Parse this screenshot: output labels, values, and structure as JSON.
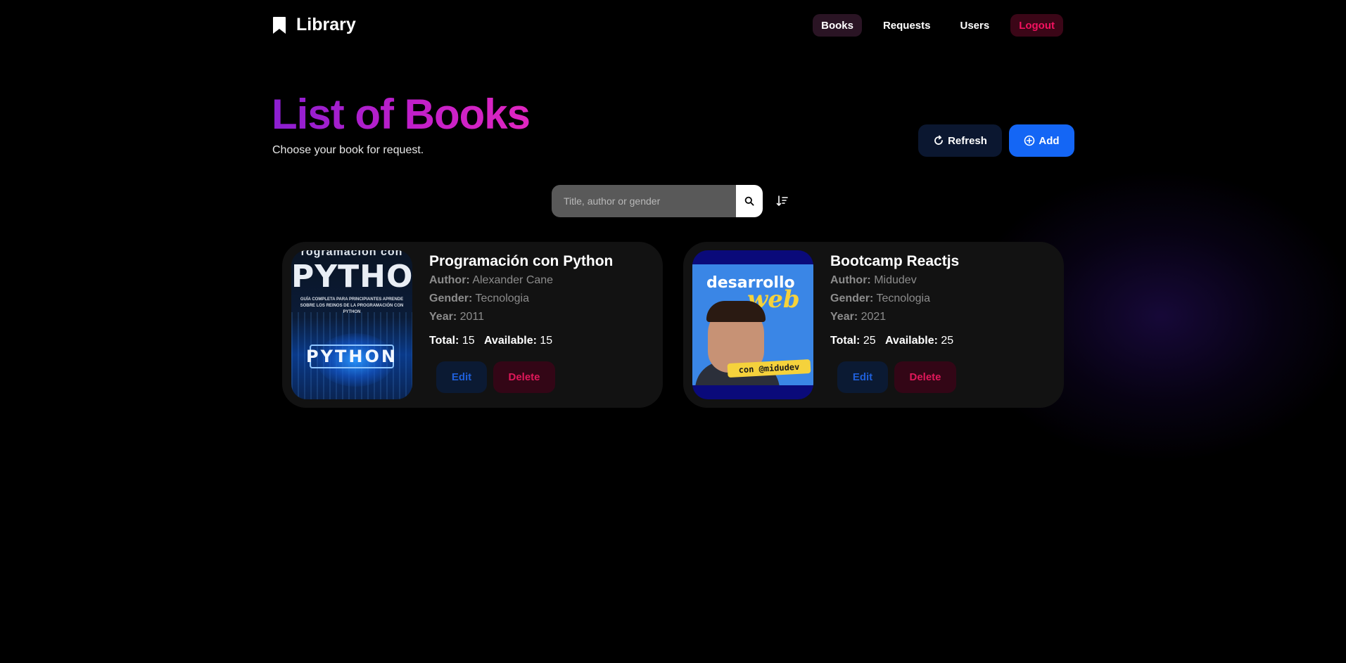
{
  "brand": {
    "title": "Library",
    "icon": "bookmark-icon"
  },
  "nav": {
    "books": "Books",
    "requests": "Requests",
    "users": "Users",
    "logout": "Logout"
  },
  "header": {
    "title": "List of Books",
    "subtitle": "Choose your book for request."
  },
  "actions": {
    "refresh": "Refresh",
    "add": "Add"
  },
  "search": {
    "placeholder": "Title, author or gender",
    "value": ""
  },
  "labels": {
    "author": "Author:",
    "gender": "Gender:",
    "year": "Year:",
    "total": "Total:",
    "available": "Available:",
    "edit": "Edit",
    "delete": "Delete"
  },
  "books": [
    {
      "title": "Programación con Python",
      "author": "Alexander Cane",
      "gender": "Tecnologia",
      "year": "2011",
      "total": "15",
      "available": "15",
      "cover": {
        "top": "rogramacion con",
        "big": "PYTHON",
        "sub": "GUÍA COMPLETA PARA PRINCIPIANTES APRENDE SOBRE LOS REINOS DE LA PROGRAMACIÓN CON PYTHON",
        "box": "PYTHON"
      }
    },
    {
      "title": "Bootcamp Reactjs",
      "author": "Midudev",
      "gender": "Tecnologia",
      "year": "2021",
      "total": "25",
      "available": "25",
      "cover": {
        "line1": "desarrollo",
        "line2": "web",
        "tag": "con @midudev"
      }
    }
  ],
  "colors": {
    "accent_blue": "#1466f5",
    "danger": "#f31260",
    "title_gradient_start": "#8b1fd1",
    "title_gradient_end": "#e026c0"
  }
}
